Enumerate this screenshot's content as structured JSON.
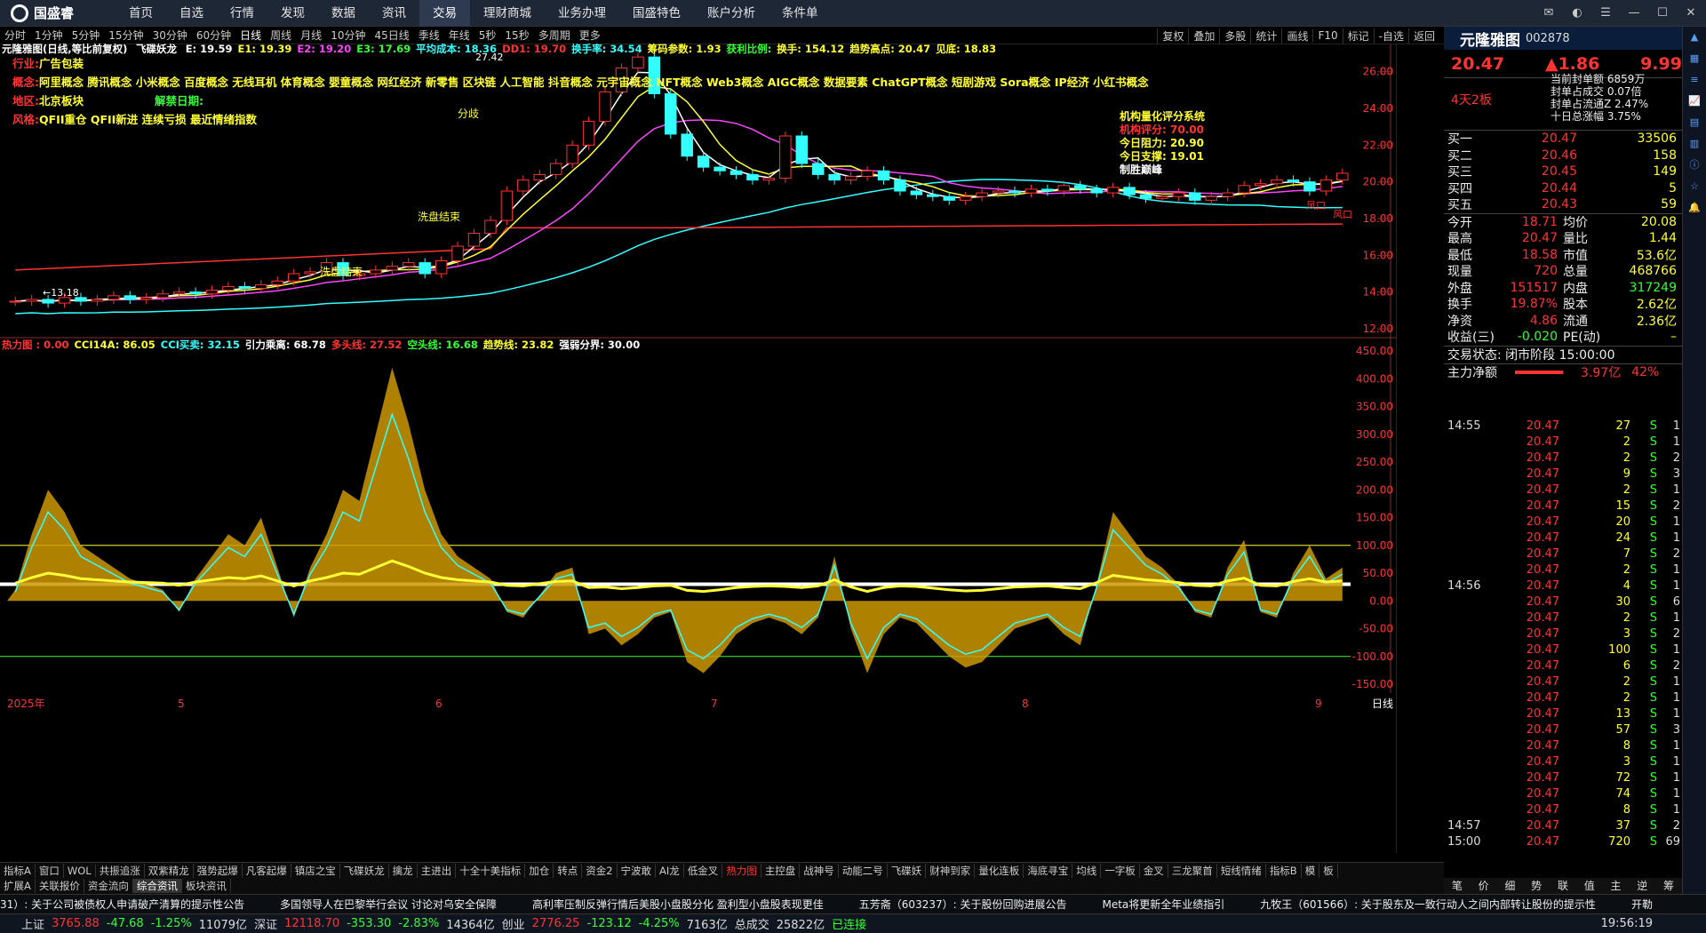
{
  "app": {
    "logo": "国盛睿",
    "menu": [
      "首页",
      "自选",
      "行情",
      "发现",
      "数据",
      "资讯",
      "交易",
      "理财商城",
      "业务办理",
      "国盛特色",
      "账户分析",
      "条件单"
    ],
    "active_menu": "交易"
  },
  "periods": [
    "分时",
    "1分钟",
    "5分钟",
    "15分钟",
    "30分钟",
    "60分钟",
    "日线",
    "周线",
    "月线",
    "10分钟",
    "45日线",
    "季线",
    "年线",
    "5秒",
    "15秒",
    "多周期",
    "更多"
  ],
  "right_tools": [
    "复权",
    "叠加",
    "多股",
    "统计",
    "画线",
    "F10",
    "标记",
    "-自选",
    "返回"
  ],
  "stock": {
    "name": "元隆雅图",
    "code": "002878",
    "price": "20.47",
    "change": "▲1.86",
    "pct": "9.99%",
    "board": "4天2板"
  },
  "main_legend": {
    "title": "元隆雅图(日线,等比前复权)",
    "indicator": "飞碟妖龙",
    "items": [
      "E: 19.59",
      "E1: 19.39",
      "E2: 19.20",
      "E3: 17.69",
      "平均成本: 18.36",
      "DD1: 19.70",
      "换手率: 34.54",
      "筹码参数: 1.93",
      "获利比例:",
      "换手: 154.12",
      "趋势高点: 20.47",
      "见底: 18.83"
    ]
  },
  "info": {
    "industry_label": "行业:",
    "industry": "广告包装",
    "concept_label": "概念:",
    "concepts": "阿里概念 腾讯概念 小米概念 百度概念 无线耳机 体育概念 婴童概念 网红经济 新零售 区块链 人工智能 抖音概念 元宇宙概念 NFT概念 Web3概念 AIGC概念 数据要素 ChatGPT概念 短剧游戏 Sora概念 IP经济 小红书概念",
    "region_label": "地区:",
    "region": "北京板块",
    "unlock_label": "解禁日期:",
    "style_label": "风格:",
    "style": "QFII重仓 QFII新进 连续亏损 最近情绪指数"
  },
  "scoring": {
    "title": "机构量化评分系统",
    "score": "机构评分: 70.00",
    "resist": "今日阻力: 20.90",
    "support": "今日支撑: 19.01",
    "verdict": "制胜巅峰"
  },
  "price_axis": [
    "26.00",
    "24.00",
    "22.00",
    "20.00",
    "18.00",
    "16.00",
    "14.00",
    "12.00"
  ],
  "low_label": "←13.18",
  "high_label": "27.42",
  "labels_main": [
    "洗盘结束",
    "洗盘结束",
    "分歧",
    "风口",
    "风口"
  ],
  "heat_legend": [
    "热力图 : 0.00",
    "CCI14A: 86.05",
    "CCI买卖: 32.15",
    "引力乘离: 68.78",
    "多头线: 27.52",
    "空头线: 16.68",
    "趋势线: 23.82",
    "强弱分界: 30.00"
  ],
  "heat_axis": [
    "450.00",
    "400.00",
    "350.00",
    "300.00",
    "250.00",
    "200.00",
    "150.00",
    "100.00",
    "50.00",
    "0.00",
    "-50.00",
    "-100.00",
    "-150.00"
  ],
  "months": [
    "2025年",
    "5",
    "6",
    "7",
    "8",
    "9"
  ],
  "bottom_period": "日线",
  "bottom_tabs": [
    "指标A",
    "窗口",
    "WOL",
    "共振追涨",
    "双紫精龙",
    "强势起爆",
    "凡客起爆",
    "镇店之宝",
    "飞碟妖龙",
    "擒龙",
    "主进出",
    "十全十美指标",
    "加仓",
    "转点",
    "资金2",
    "宁波敢",
    "AI龙",
    "低金叉",
    "热力图",
    "主控盘",
    "战神号",
    "动能二号",
    "飞碟妖",
    "财神到家",
    "量化连板",
    "海底寻宝",
    "均线",
    "一字板",
    "金叉",
    "三龙聚首",
    "短线情绪",
    "指标B",
    "模",
    "板"
  ],
  "bottom_tabs2": [
    "扩展A",
    "关联报价",
    "资金流向",
    "综合资讯",
    "板块资讯"
  ],
  "bottom_sel2": "综合资讯",
  "summary_stats": {
    "limit_vol": "当前封单额 6859万",
    "limit_ratio": "封单占成交 0.07倍",
    "limit_float": "封单占流通Z 2.47%",
    "ten_day": "十日总涨幅 3.75%"
  },
  "orderbook": [
    {
      "label": "买一",
      "price": "20.47",
      "vol": "33506"
    },
    {
      "label": "买二",
      "price": "20.46",
      "vol": "158"
    },
    {
      "label": "买三",
      "price": "20.45",
      "vol": "149"
    },
    {
      "label": "买四",
      "price": "20.44",
      "vol": "5"
    },
    {
      "label": "买五",
      "price": "20.43",
      "vol": "59"
    }
  ],
  "stats": [
    {
      "l": "今开",
      "v": "18.71",
      "l2": "均价",
      "v2": "20.08"
    },
    {
      "l": "最高",
      "v": "20.47",
      "l2": "量比",
      "v2": "1.44"
    },
    {
      "l": "最低",
      "v": "18.58",
      "l2": "市值",
      "v2": "53.6亿"
    },
    {
      "l": "现量",
      "v": "720",
      "l2": "总量",
      "v2": "468766"
    },
    {
      "l": "外盘",
      "v": "151517",
      "l2": "内盘",
      "v2": "317249"
    },
    {
      "l": "换手",
      "v": "19.87%",
      "l2": "股本",
      "v2": "2.62亿"
    },
    {
      "l": "净资",
      "v": "4.86",
      "l2": "流通",
      "v2": "2.36亿"
    },
    {
      "l": "收益(三)",
      "v": "-0.020",
      "l2": "PE(动)",
      "v2": "–"
    }
  ],
  "trade_state": "交易状态: 闭市阶段 15:00:00",
  "main_net": {
    "label": "主力净额",
    "value": "3.97亿",
    "pct": "42%"
  },
  "ticks": [
    {
      "t": "14:55",
      "p": "20.47",
      "q": "27",
      "s": "S",
      "n": "1"
    },
    {
      "t": "",
      "p": "20.47",
      "q": "2",
      "s": "S",
      "n": "1"
    },
    {
      "t": "",
      "p": "20.47",
      "q": "2",
      "s": "S",
      "n": "2"
    },
    {
      "t": "",
      "p": "20.47",
      "q": "9",
      "s": "S",
      "n": "3"
    },
    {
      "t": "",
      "p": "20.47",
      "q": "2",
      "s": "S",
      "n": "1"
    },
    {
      "t": "",
      "p": "20.47",
      "q": "15",
      "s": "S",
      "n": "2"
    },
    {
      "t": "",
      "p": "20.47",
      "q": "20",
      "s": "S",
      "n": "1"
    },
    {
      "t": "",
      "p": "20.47",
      "q": "24",
      "s": "S",
      "n": "1"
    },
    {
      "t": "",
      "p": "20.47",
      "q": "7",
      "s": "S",
      "n": "2"
    },
    {
      "t": "",
      "p": "20.47",
      "q": "2",
      "s": "S",
      "n": "1"
    },
    {
      "t": "14:56",
      "p": "20.47",
      "q": "4",
      "s": "S",
      "n": "1"
    },
    {
      "t": "",
      "p": "20.47",
      "q": "30",
      "s": "S",
      "n": "6"
    },
    {
      "t": "",
      "p": "20.47",
      "q": "2",
      "s": "S",
      "n": "1"
    },
    {
      "t": "",
      "p": "20.47",
      "q": "3",
      "s": "S",
      "n": "2"
    },
    {
      "t": "",
      "p": "20.47",
      "q": "100",
      "s": "S",
      "n": "1"
    },
    {
      "t": "",
      "p": "20.47",
      "q": "6",
      "s": "S",
      "n": "2"
    },
    {
      "t": "",
      "p": "20.47",
      "q": "2",
      "s": "S",
      "n": "1"
    },
    {
      "t": "",
      "p": "20.47",
      "q": "2",
      "s": "S",
      "n": "1"
    },
    {
      "t": "",
      "p": "20.47",
      "q": "13",
      "s": "S",
      "n": "1"
    },
    {
      "t": "",
      "p": "20.47",
      "q": "57",
      "s": "S",
      "n": "3"
    },
    {
      "t": "",
      "p": "20.47",
      "q": "8",
      "s": "S",
      "n": "1"
    },
    {
      "t": "",
      "p": "20.47",
      "q": "3",
      "s": "S",
      "n": "1"
    },
    {
      "t": "",
      "p": "20.47",
      "q": "72",
      "s": "S",
      "n": "1"
    },
    {
      "t": "",
      "p": "20.47",
      "q": "74",
      "s": "S",
      "n": "1"
    },
    {
      "t": "",
      "p": "20.47",
      "q": "8",
      "s": "S",
      "n": "1"
    },
    {
      "t": "14:57",
      "p": "20.47",
      "q": "37",
      "s": "S",
      "n": "2"
    },
    {
      "t": "15:00",
      "p": "20.47",
      "q": "720",
      "s": "S",
      "n": "69"
    }
  ],
  "right_tabs": [
    "笔",
    "价",
    "细",
    "势",
    "联",
    "值",
    "主",
    "逆",
    "筹"
  ],
  "news": [
    "31）: 关于公司被债权人申请破产清算的提示性公告",
    "多国领导人在巴黎举行会议 讨论对乌安全保障",
    "高利率压制反弹行情后美股小盘股分化 盈利型小盘股表现更佳",
    "五芳斋（603237）: 关于股份回购进展公告",
    "Meta将更新全年业绩指引",
    "九牧王（601566）: 关于股东及一致行动人之间内部转让股份的提示性",
    "开勒"
  ],
  "status": {
    "sh_label": "上证",
    "sh": "3765.88",
    "sh_chg": "-47.68",
    "sh_pct": "-1.25%",
    "sh_amt": "11079亿",
    "sz_label": "深证",
    "sz": "12118.70",
    "sz_chg": "-353.30",
    "sz_pct": "-2.83%",
    "sz_amt": "14364亿",
    "cy_label": "创业",
    "cy": "2776.25",
    "cy_chg": "-123.12",
    "cy_pct": "-4.25%",
    "cy_amt": "7163亿",
    "total_label": "总成交",
    "total": "25822亿",
    "conn": "已连接",
    "time": "19:56:19"
  },
  "colors": {
    "up": "#ff3333",
    "down": "#33ffff",
    "gold": "#d4a017",
    "magenta": "#cc22cc"
  },
  "chart_data": {
    "type": "candlestick",
    "closes": [
      13.5,
      13.6,
      13.4,
      13.7,
      13.5,
      13.6,
      13.8,
      13.6,
      13.7,
      13.9,
      14.0,
      13.9,
      14.1,
      14.3,
      14.2,
      14.4,
      14.6,
      15.0,
      15.1,
      15.6,
      14.9,
      15.0,
      15.2,
      15.4,
      15.6,
      15.0,
      15.7,
      16.5,
      17.2,
      17.9,
      19.5,
      20.1,
      20.4,
      21.0,
      22.0,
      23.3,
      24.9,
      26.2,
      26.8,
      24.8,
      22.6,
      21.4,
      20.8,
      20.6,
      20.4,
      20.1,
      20.2,
      22.5,
      21.0,
      20.4,
      20.1,
      20.3,
      20.6,
      20.1,
      19.5,
      19.3,
      19.2,
      19.0,
      19.2,
      19.4,
      19.5,
      19.4,
      19.6,
      19.5,
      19.8,
      19.6,
      19.4,
      19.7,
      19.3,
      19.1,
      19.2,
      19.4,
      19.0,
      19.2,
      19.4,
      19.8,
      19.9,
      20.1,
      20.0,
      19.5,
      20.1,
      20.47
    ],
    "ylim": [
      12,
      27
    ]
  }
}
